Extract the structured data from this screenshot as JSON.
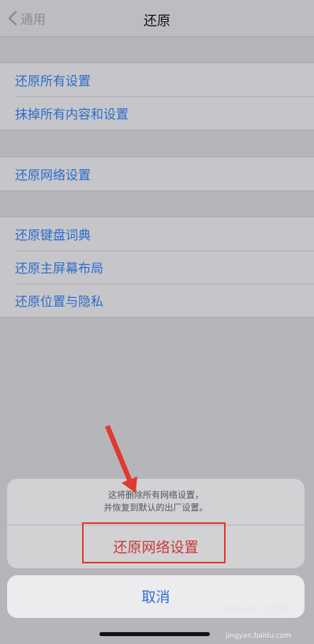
{
  "nav": {
    "back_label": "通用",
    "title": "还原"
  },
  "groups": [
    {
      "items": [
        "还原所有设置",
        "抹掉所有内容和设置"
      ]
    },
    {
      "items": [
        "还原网络设置"
      ]
    },
    {
      "items": [
        "还原键盘词典",
        "还原主屏幕布局",
        "还原位置与隐私"
      ]
    }
  ],
  "action_sheet": {
    "message_line1": "这将删除所有网络设置，",
    "message_line2": "并恢复到默认的出厂设置。",
    "confirm_label": "还原网络设置",
    "cancel_label": "取消"
  },
  "watermark": {
    "logo": "Baidu 经验",
    "site": "jingyan.baidu.com"
  },
  "colors": {
    "link": "#2c6cc9",
    "destructive": "#c83a34",
    "annotation": "#e03a2f"
  }
}
